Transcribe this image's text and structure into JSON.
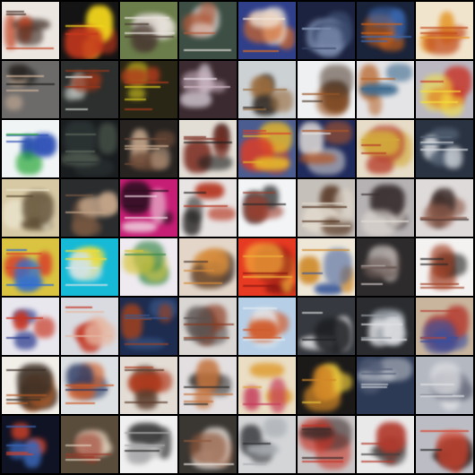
{
  "grid": {
    "rows": 8,
    "cols": 8
  },
  "tiles": [
    [
      "#ece6e1",
      "#c2411f",
      "#3c2a22"
    ],
    [
      "#141414",
      "#f2d51c",
      "#c8381d"
    ],
    [
      "#6b7d4a",
      "#e8e2dc",
      "#4a3b32"
    ],
    [
      "#3d4f45",
      "#e9e1de",
      "#b45a3a"
    ],
    [
      "#2f3f8a",
      "#e46d20",
      "#f1e6d9"
    ],
    [
      "#1c2340",
      "#3a4a6d",
      "#8090b2"
    ],
    [
      "#19233a",
      "#cd6219",
      "#3b6ab5"
    ],
    [
      "#f1e4cd",
      "#e59a2f",
      "#c34d1c"
    ],
    [
      "#6d6b6a",
      "#1d1c1b",
      "#d2b59b"
    ],
    [
      "#2c2f2d",
      "#d2d7d3",
      "#9a3519"
    ],
    [
      "#2a2616",
      "#d6c91f",
      "#b33b1d"
    ],
    [
      "#3b2a2f",
      "#e7dde8",
      "#d1b8c6"
    ],
    [
      "#ccd1d4",
      "#2e2620",
      "#9a6b3c"
    ],
    [
      "#eef0f2",
      "#9c5624",
      "#4f3b2d"
    ],
    [
      "#e4e4e6",
      "#b7652b",
      "#3d6a8f"
    ],
    [
      "#bbb8c1",
      "#c83225",
      "#f5e03e"
    ],
    [
      "#f0f4f5",
      "#29a838",
      "#2d4fb6"
    ],
    [
      "#1a1d1f",
      "#2d3535",
      "#5d695c"
    ],
    [
      "#262321",
      "#6e4b38",
      "#c7a88d"
    ],
    [
      "#e2ded6",
      "#1f1f1f",
      "#7b2c20"
    ],
    [
      "#4b5d90",
      "#d93e2a",
      "#e4b62c"
    ],
    [
      "#1f2b5c",
      "#e8e2dc",
      "#b35829"
    ],
    [
      "#e6dcc8",
      "#d3aa3b",
      "#b43a26"
    ],
    [
      "#2a3342",
      "#58677a",
      "#d9dde2"
    ],
    [
      "#d8c9a5",
      "#e9e2ca",
      "#5b4b32"
    ],
    [
      "#2a2c2e",
      "#7b5a42",
      "#c2a488"
    ],
    [
      "#c61e74",
      "#2f0f22",
      "#f0d6e1"
    ],
    [
      "#e8e4e3",
      "#262423",
      "#b53924"
    ],
    [
      "#f2f4f6",
      "#2c2c2c",
      "#9c3d2c"
    ],
    [
      "#c5c0ba",
      "#5a3b28",
      "#e0d8cc"
    ],
    [
      "#b6b2b3",
      "#3a3032",
      "#e3ddd6"
    ],
    [
      "#dedad9",
      "#3b2c2a",
      "#8c5a49"
    ],
    [
      "#d9c341",
      "#d8452a",
      "#2f6dd1"
    ],
    [
      "#16b9d6",
      "#f1dd3b",
      "#d2e4ea"
    ],
    [
      "#eeeaf0",
      "#3c8a4f",
      "#d7c43a"
    ],
    [
      "#e3d6c9",
      "#4a3830",
      "#d68b3b"
    ],
    [
      "#e63a22",
      "#8a1812",
      "#f2b13b"
    ],
    [
      "#eee7d8",
      "#d08c2e",
      "#3c5a9a"
    ],
    [
      "#2e2b2c",
      "#c9c2bf",
      "#6d5c57"
    ],
    [
      "#f4f2f1",
      "#2c2a29",
      "#a4452a"
    ],
    [
      "#e9e7ee",
      "#2f3f8f",
      "#c73320"
    ],
    [
      "#d9dbe0",
      "#c2311e",
      "#e6b8a3"
    ],
    [
      "#1d2c4f",
      "#3b5a8e",
      "#9a4121"
    ],
    [
      "#d9d6d4",
      "#8b3a20",
      "#5c5452"
    ],
    [
      "#b7cfe6",
      "#e2ecf3",
      "#d05a2a"
    ],
    [
      "#36393f",
      "#d7d8da",
      "#1c1e21"
    ],
    [
      "#2a2c2f",
      "#9aa0a8",
      "#dfe1e4"
    ],
    [
      "#c9b59d",
      "#b6463a",
      "#3a4f9c"
    ],
    [
      "#f2efe9",
      "#b45a24",
      "#3d3026"
    ],
    [
      "#dde0e2",
      "#2c3a63",
      "#cf5a25"
    ],
    [
      "#e2dcd4",
      "#b13a1c",
      "#5b3a2a"
    ],
    [
      "#e3dfe0",
      "#32302f",
      "#c3743f"
    ],
    [
      "#e9ddc4",
      "#e0a13b",
      "#c53d5b"
    ],
    [
      "#1b1a19",
      "#e8c53b",
      "#d28727"
    ],
    [
      "#2d3a55",
      "#c9cdd4",
      "#58627a"
    ],
    [
      "#b4b8c1",
      "#6d7181",
      "#e2e3e6"
    ],
    [
      "#0f1324",
      "#d24229",
      "#3b67b8"
    ],
    [
      "#5a4c3b",
      "#e0cfbb",
      "#9a3a2a"
    ],
    [
      "#f1f0f0",
      "#2f2e2e",
      "#a9a9ab"
    ],
    [
      "#3a3632",
      "#e9e3dd",
      "#91593d"
    ],
    [
      "#d3d5d7",
      "#2b2d30",
      "#a8acb1"
    ],
    [
      "#c9c5c6",
      "#c83326",
      "#3c2b2a"
    ],
    [
      "#eae9ea",
      "#43403f",
      "#b23a2d"
    ],
    [
      "#bcbdc4",
      "#292929",
      "#d9452f"
    ]
  ]
}
